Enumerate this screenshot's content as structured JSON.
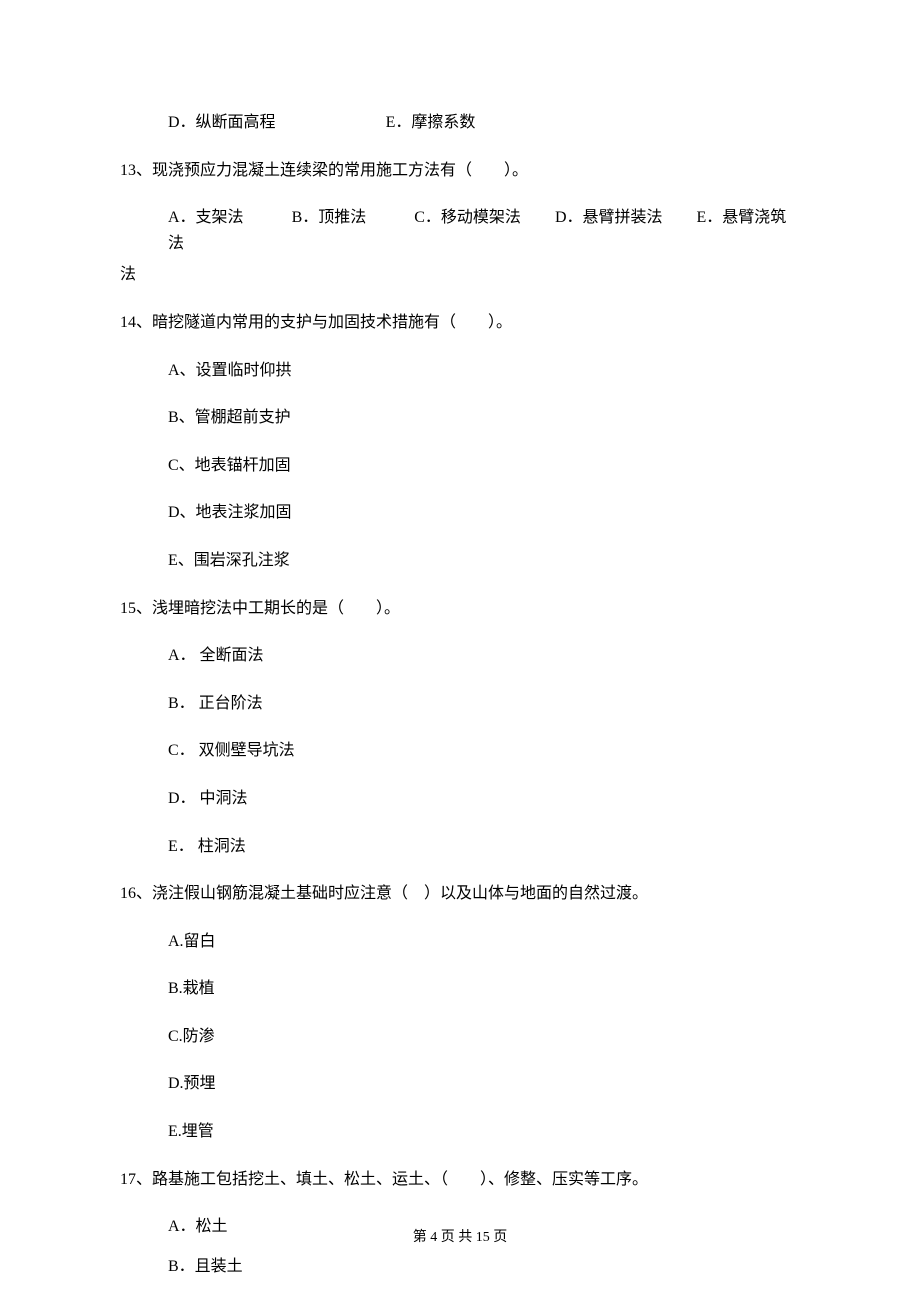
{
  "q12": {
    "optD": "D．纵断面高程",
    "optE": "E．摩擦系数"
  },
  "q13": {
    "stem": "13、现浇预应力混凝土连续梁的常用施工方法有（　　）。",
    "optA": "A．支架法",
    "optB": "B．顶推法",
    "optC": "C．移动模架法",
    "optD": "D．悬臂拼装法",
    "optE": "E．悬臂浇筑法",
    "tail": "法"
  },
  "q14": {
    "stem": "14、暗挖隧道内常用的支护与加固技术措施有（　　）。",
    "optA": "A、设置临时仰拱",
    "optB": "B、管棚超前支护",
    "optC": "C、地表锚杆加固",
    "optD": "D、地表注浆加固",
    "optE": "E、围岩深孔注浆"
  },
  "q15": {
    "stem": "15、浅埋暗挖法中工期长的是（　　）。",
    "optA": "A． 全断面法",
    "optB": "B． 正台阶法",
    "optC": "C． 双侧壁导坑法",
    "optD": "D． 中洞法",
    "optE": "E． 柱洞法"
  },
  "q16": {
    "stem": "16、浇注假山钢筋混凝土基础时应注意（　）以及山体与地面的自然过渡。",
    "optA": "A.留白",
    "optB": "B.栽植",
    "optC": "C.防渗",
    "optD": "D.预埋",
    "optE": "E.埋管"
  },
  "q17": {
    "stem": "17、路基施工包括挖土、填土、松土、运土、（　　）、修整、压实等工序。",
    "optA": "A．松土",
    "optB": "B．且装土"
  },
  "footer": "第 4 页 共 15 页"
}
